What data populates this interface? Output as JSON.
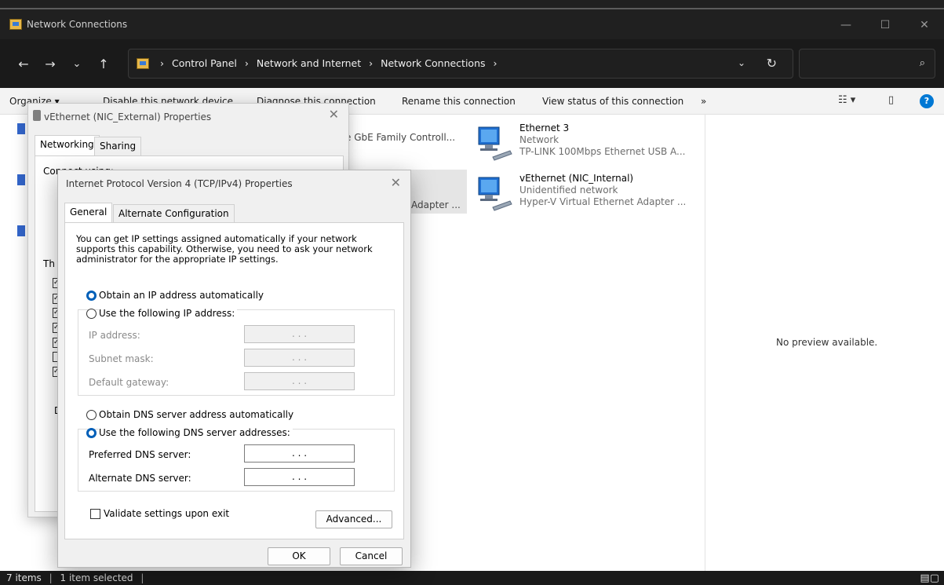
{
  "window": {
    "title": "Network Connections",
    "controls": {
      "minimize": "—",
      "maximize": "☐",
      "close": "✕"
    }
  },
  "nav": {
    "back": "←",
    "forward": "→",
    "recent": "⌄",
    "up": "↑"
  },
  "address": {
    "crumbs": [
      "Control Panel",
      "Network and Internet",
      "Network Connections"
    ],
    "separator": "›",
    "dropdown": "⌄",
    "refresh": "↻"
  },
  "search": {
    "icon": "⌕"
  },
  "commands": {
    "organize": "Organize ▾",
    "disable": "Disable this network device",
    "diagnose": "Diagnose this connection",
    "rename": "Rename this connection",
    "view_status": "View status of this connection",
    "more": "»",
    "view_options": "☷ ▾",
    "pane": "▯",
    "help": "?"
  },
  "items": [
    {
      "name": "Ethernet 3",
      "status": "Network",
      "device": "TP-LINK 100Mbps Ethernet USB A..."
    },
    {
      "name": "vEthernet (NIC_Internal)",
      "status": "Unidentified network",
      "device": "Hyper-V Virtual Ethernet Adapter ..."
    }
  ],
  "partial_items": [
    "e GbE Family Controll...",
    "Adapter ..."
  ],
  "preview": {
    "text": "No preview available."
  },
  "status": {
    "count": "7 items",
    "selected": "1 item selected",
    "sep": "|",
    "view_icons": "▤▢"
  },
  "vprops": {
    "title": "vEthernet (NIC_External) Properties",
    "close": "✕",
    "tabs": [
      "Networking",
      "Sharing"
    ],
    "connect_label": "Connect using:",
    "this_label": "Th",
    "partial_label": "D"
  },
  "ipv4": {
    "title": "Internet Protocol Version 4 (TCP/IPv4) Properties",
    "close": "✕",
    "tabs": [
      "General",
      "Alternate Configuration"
    ],
    "description": "You can get IP settings assigned automatically if your network supports this capability. Otherwise, you need to ask your network administrator for the appropriate IP settings.",
    "obtain_ip": "Obtain an IP address automatically",
    "use_ip": "Use the following IP address:",
    "ip_address": "IP address:",
    "subnet_mask": "Subnet mask:",
    "default_gateway": "Default gateway:",
    "empty_ip": ".    .    .",
    "obtain_dns": "Obtain DNS server address automatically",
    "use_dns": "Use the following DNS server addresses:",
    "preferred_dns": "Preferred DNS server:",
    "alternate_dns": "Alternate DNS server:",
    "validate": "Validate settings upon exit",
    "advanced": "Advanced...",
    "ok": "OK",
    "cancel": "Cancel"
  },
  "colors": {
    "accent": "#005fb8",
    "help": "#0078d4",
    "dark_chrome": "#202020"
  }
}
